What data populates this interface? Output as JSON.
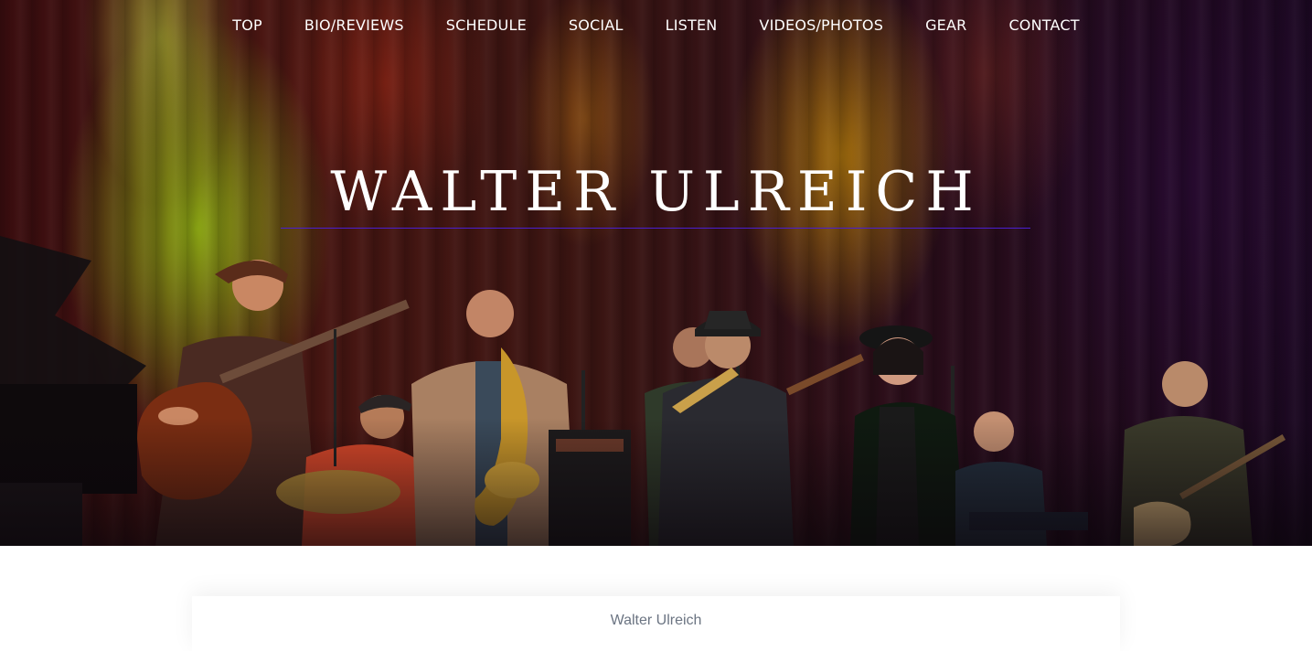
{
  "nav": {
    "items": [
      {
        "label": "TOP"
      },
      {
        "label": "BIO/REVIEWS"
      },
      {
        "label": "SCHEDULE"
      },
      {
        "label": "SOCIAL"
      },
      {
        "label": "LISTEN"
      },
      {
        "label": "VIDEOS/PHOTOS"
      },
      {
        "label": "GEAR"
      },
      {
        "label": "CONTACT"
      }
    ]
  },
  "hero": {
    "title": "WALTER ULREICH",
    "rule_color": "#4a1fd0"
  },
  "content": {
    "label": "Walter Ulreich"
  },
  "colors": {
    "nav_text": "#ffffff",
    "content_text": "#6b7482",
    "page_bg": "#ffffff"
  }
}
